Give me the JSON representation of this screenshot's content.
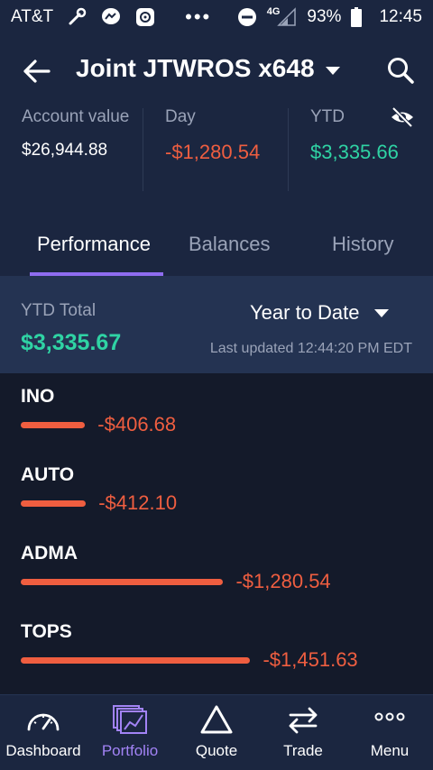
{
  "status_bar": {
    "carrier": "AT&T",
    "battery": "93%",
    "time": "12:45",
    "network": "4G",
    "more": "•••"
  },
  "header": {
    "account_title": "Joint JTWROS x648",
    "stats": {
      "account_value_label": "Account value",
      "account_value": "$26,944.88",
      "day_label": "Day",
      "day_value": "-$1,280.54",
      "ytd_label": "YTD",
      "ytd_value": "$3,335.66"
    },
    "tabs": [
      {
        "label": "Performance",
        "active": true
      },
      {
        "label": "Balances",
        "active": false
      },
      {
        "label": "History",
        "active": false
      }
    ]
  },
  "summary": {
    "ytd_total_label": "YTD Total",
    "ytd_total_value": "$3,335.67",
    "range_label": "Year to Date",
    "last_updated": "Last updated 12:44:20 PM EDT"
  },
  "holdings": [
    {
      "ticker": "INO",
      "amount": "-$406.68",
      "value": -406.68
    },
    {
      "ticker": "AUTO",
      "amount": "-$412.10",
      "value": -412.1
    },
    {
      "ticker": "ADMA",
      "amount": "-$1,280.54",
      "value": -1280.54
    },
    {
      "ticker": "TOPS",
      "amount": "-$1,451.63",
      "value": -1451.63
    }
  ],
  "bottom_nav": [
    {
      "label": "Dashboard",
      "icon": "gauge-icon",
      "active": false
    },
    {
      "label": "Portfolio",
      "icon": "portfolio-icon",
      "active": true
    },
    {
      "label": "Quote",
      "icon": "triangle-icon",
      "active": false
    },
    {
      "label": "Trade",
      "icon": "swap-arrows-icon",
      "active": false
    },
    {
      "label": "Menu",
      "icon": "more-dots-icon",
      "active": false
    }
  ],
  "colors": {
    "negative": "#ef5e40",
    "positive": "#2fd3a4",
    "accent": "#8f6df0"
  }
}
